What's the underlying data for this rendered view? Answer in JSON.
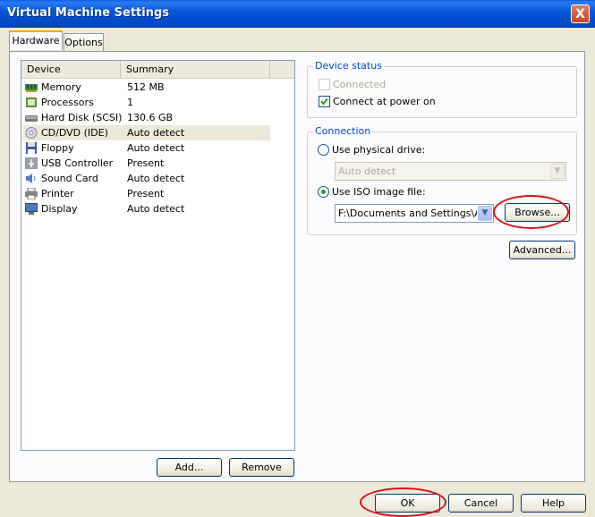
{
  "window": {
    "title": "Virtual Machine Settings",
    "close_glyph": "X"
  },
  "tabs": [
    {
      "label": "Hardware"
    },
    {
      "label": "Options"
    }
  ],
  "device_list": {
    "columns": [
      "Device",
      "Summary"
    ],
    "rows": [
      {
        "device": "Memory",
        "summary": "512 MB",
        "icon": "memory-icon"
      },
      {
        "device": "Processors",
        "summary": "1",
        "icon": "processor-icon"
      },
      {
        "device": "Hard Disk (SCSI)",
        "summary": "130.6 GB",
        "icon": "hard-disk-icon"
      },
      {
        "device": "CD/DVD (IDE)",
        "summary": "Auto detect",
        "icon": "cd-dvd-icon",
        "selected": true
      },
      {
        "device": "Floppy",
        "summary": "Auto detect",
        "icon": "floppy-icon"
      },
      {
        "device": "USB Controller",
        "summary": "Present",
        "icon": "usb-icon"
      },
      {
        "device": "Sound Card",
        "summary": "Auto detect",
        "icon": "sound-card-icon"
      },
      {
        "device": "Printer",
        "summary": "Present",
        "icon": "printer-icon"
      },
      {
        "device": "Display",
        "summary": "Auto detect",
        "icon": "display-icon"
      }
    ],
    "add_label": "Add...",
    "remove_label": "Remove"
  },
  "device_status": {
    "legend": "Device status",
    "connected_label": "Connected",
    "connected_checked": false,
    "connect_power_on_label": "Connect at power on",
    "connect_power_on_checked": true
  },
  "connection": {
    "legend": "Connection",
    "physical_label": "Use physical drive:",
    "physical_value": "Auto detect",
    "iso_label": "Use ISO image file:",
    "iso_value": "F:\\Documents and Settings\\Adr",
    "selected_option": "iso",
    "browse_label": "Browse..."
  },
  "advanced_label": "Advanced...",
  "footer": {
    "ok_label": "OK",
    "cancel_label": "Cancel",
    "help_label": "Help"
  },
  "colors": {
    "highlight_ellipse": "#d81018",
    "title_bar": "#0558d8",
    "group_legend": "#0046d5"
  }
}
